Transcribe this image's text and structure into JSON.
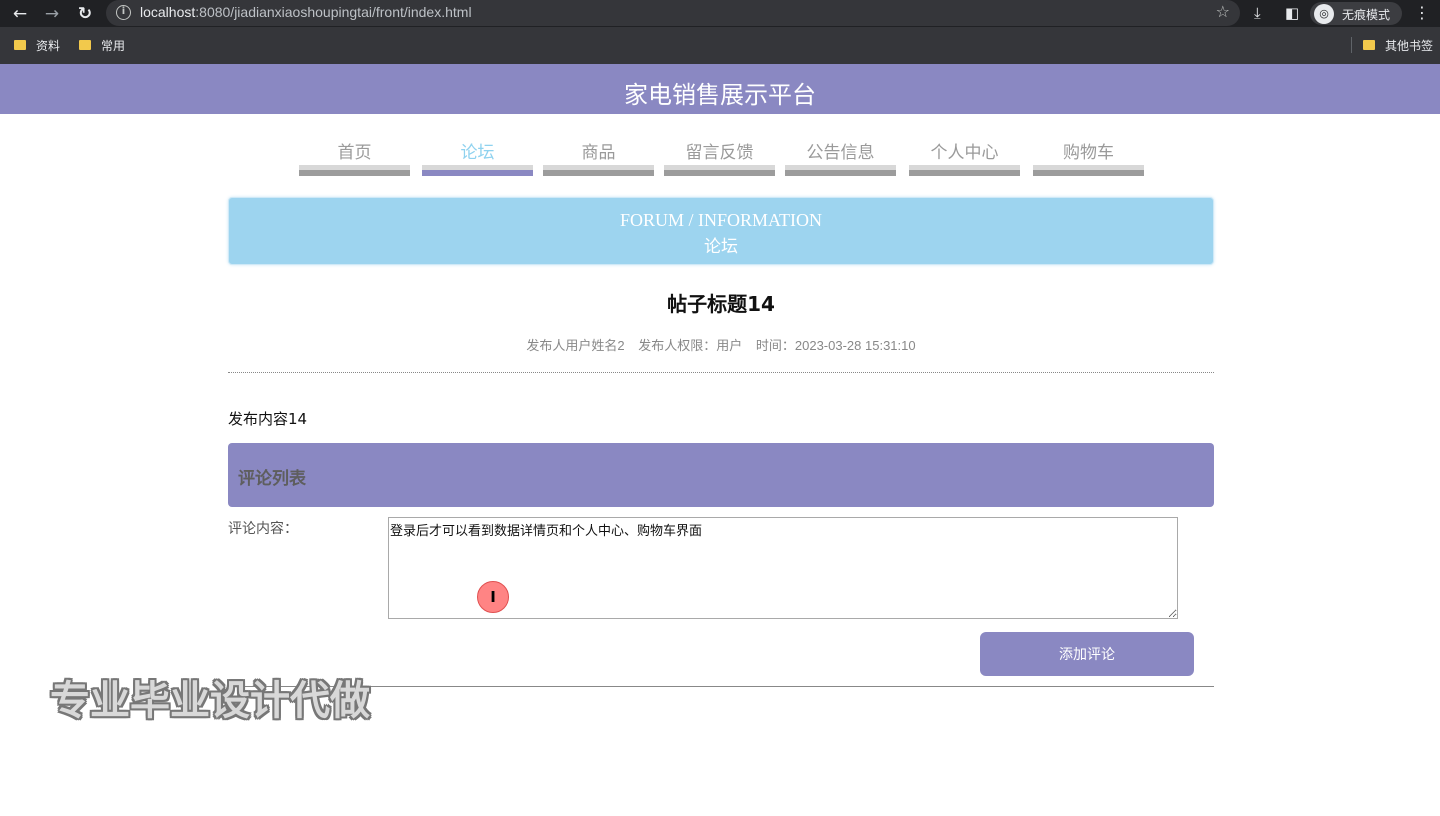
{
  "browser": {
    "url_host": "localhost",
    "url_path": ":8080/jiadianxiaoshoupingtai/front/index.html",
    "incognito_label": "无痕模式",
    "bookmarks": [
      {
        "label": "资料"
      },
      {
        "label": "常用"
      }
    ],
    "other_bookmarks_label": "其他书签",
    "icons": {
      "back": "←",
      "forward": "→",
      "reload": "↻",
      "info": "i",
      "star": "☆",
      "download": "⤓",
      "sidepanel": "◧",
      "incognito": "◎",
      "menu": "⋮"
    }
  },
  "site": {
    "title": "家电销售展示平台",
    "accent_color": "#8a88c2",
    "active_nav_color": "#8fd2ef"
  },
  "nav": {
    "items": [
      {
        "label": "首页"
      },
      {
        "label": "论坛"
      },
      {
        "label": "商品"
      },
      {
        "label": "留言反馈"
      },
      {
        "label": "公告信息"
      },
      {
        "label": "个人中心"
      },
      {
        "label": "购物车"
      }
    ],
    "active_index": 1
  },
  "banner": {
    "en": "FORUM / INFORMATION",
    "cn": "论坛"
  },
  "post": {
    "title": "帖子标题14",
    "author": "发布人用户姓名2",
    "role": "发布人权限：用户",
    "time": "时间：2023-03-28 15:31:10",
    "content": "发布内容14"
  },
  "comments": {
    "header": "评论列表",
    "input_label": "评论内容：",
    "input_value": "登录后才可以看到数据详情页和个人中心、购物车界面",
    "add_button": "添加评论",
    "cursor_glyph": "I"
  },
  "watermark": "专业毕业设计代做"
}
